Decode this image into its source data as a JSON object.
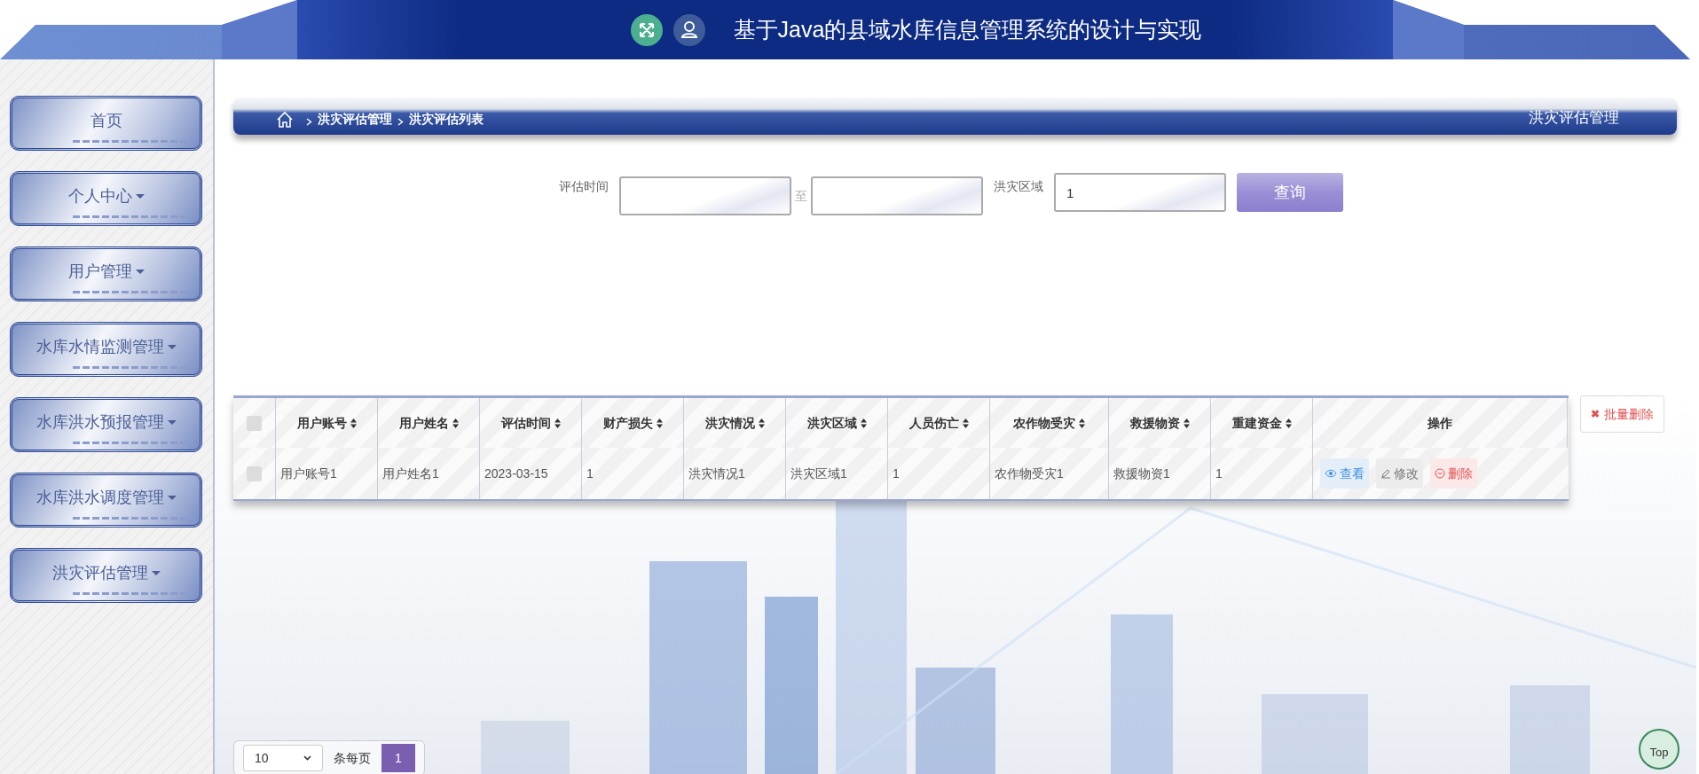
{
  "header": {
    "title": "基于Java的县域水库信息管理系统的设计与实现"
  },
  "sidebar": {
    "items": [
      {
        "label": "首页",
        "dropdown": false
      },
      {
        "label": "个人中心",
        "dropdown": true
      },
      {
        "label": "用户管理",
        "dropdown": true
      },
      {
        "label": "水库水情监测管理",
        "dropdown": true
      },
      {
        "label": "水库洪水预报管理",
        "dropdown": true
      },
      {
        "label": "水库洪水调度管理",
        "dropdown": true
      },
      {
        "label": "洪灾评估管理",
        "dropdown": true
      }
    ]
  },
  "breadcrumb": {
    "items": [
      "洪灾评估管理",
      "洪灾评估列表"
    ],
    "title": "洪灾评估管理"
  },
  "search": {
    "fields": [
      {
        "kind": "range",
        "label": "评估时间",
        "separator": "至"
      },
      {
        "kind": "text",
        "label": "洪灾区域",
        "value": "1"
      }
    ],
    "button": "查询"
  },
  "table": {
    "columns": [
      "用户账号",
      "用户姓名",
      "评估时间",
      "财产损失",
      "洪灾情况",
      "洪灾区域",
      "人员伤亡",
      "农作物受灾",
      "救援物资",
      "重建资金",
      "操作"
    ],
    "rows": [
      {
        "checked": false,
        "cells": [
          "用户账号1",
          "用户姓名1",
          "2023-03-15",
          "1",
          "洪灾情况1",
          "洪灾区域1",
          "1",
          "农作物受灾1",
          "救援物资1",
          "1"
        ],
        "actions": [
          {
            "kind": "view",
            "label": "查看"
          },
          {
            "kind": "edit",
            "label": "修改"
          },
          {
            "kind": "delete",
            "label": "删除"
          }
        ]
      }
    ],
    "header_checked": false
  },
  "batch_delete": {
    "icon": "✖",
    "label": "批量删除"
  },
  "pagination": {
    "page_size": "10",
    "page_size_label": "条每页",
    "pages": [
      {
        "label": "1",
        "selected": true
      }
    ]
  },
  "back_to_top": "Top"
}
